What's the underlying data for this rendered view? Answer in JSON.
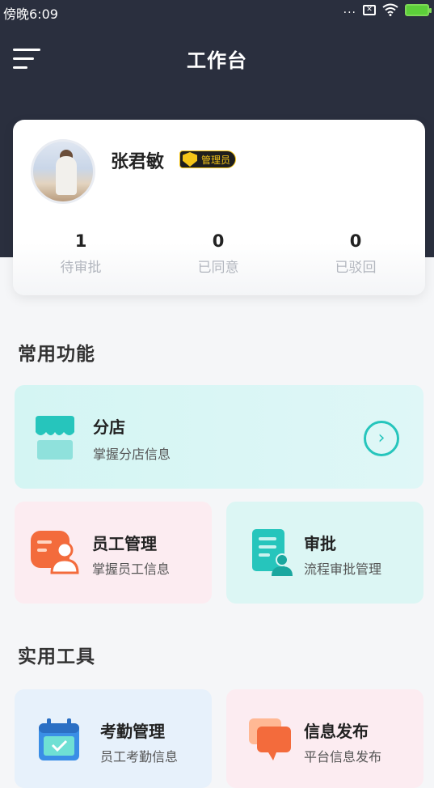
{
  "status_bar": {
    "time": "傍晚6:09",
    "dots": "...",
    "signal_box": "✕"
  },
  "header": {
    "title": "工作台"
  },
  "profile": {
    "name": "张君敏",
    "role": "管理员",
    "stats": [
      {
        "value": "1",
        "label": "待审批"
      },
      {
        "value": "0",
        "label": "已同意"
      },
      {
        "value": "0",
        "label": "已驳回"
      }
    ]
  },
  "common_functions": {
    "title": "常用功能",
    "branch": {
      "title": "分店",
      "subtitle": "掌握分店信息",
      "arrow": "›"
    },
    "staff": {
      "title": "员工管理",
      "subtitle": "掌握员工信息"
    },
    "approval": {
      "title": "审批",
      "subtitle": "流程审批管理"
    }
  },
  "tools": {
    "title": "实用工具",
    "attendance": {
      "title": "考勤管理",
      "subtitle": "员工考勤信息"
    },
    "publish": {
      "title": "信息发布",
      "subtitle": "平台信息发布"
    }
  },
  "colors": {
    "header_bg": "#2a2f3e",
    "teal": "#26c5bc",
    "orange": "#f36b3c",
    "badge_gold": "#f5c518"
  },
  "icons": [
    "menu-icon",
    "store-icon",
    "arrow-right-icon",
    "staff-icon",
    "approval-icon",
    "calendar-icon",
    "message-icon",
    "wifi-icon",
    "battery-icon",
    "shield-icon"
  ]
}
